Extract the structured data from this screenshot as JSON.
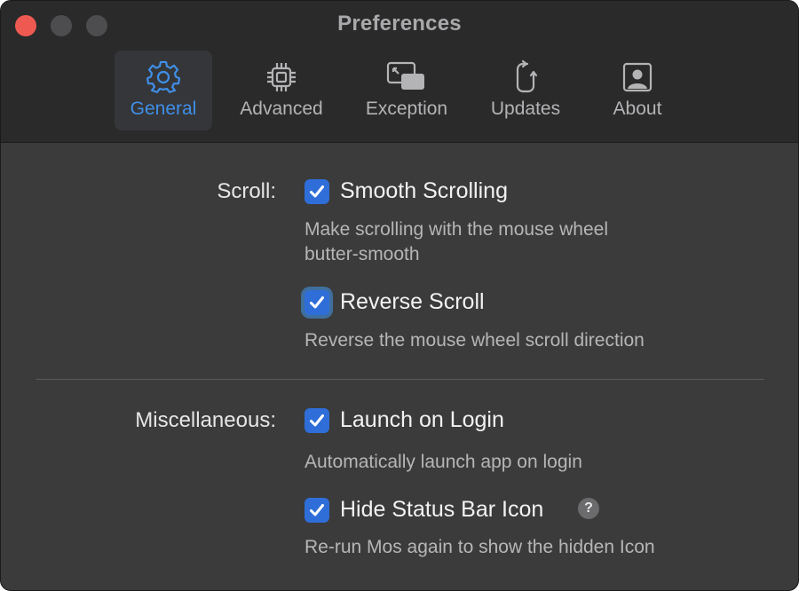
{
  "window": {
    "title": "Preferences",
    "accent_color": "#3f8fe8",
    "checkbox_color": "#2f6ed9"
  },
  "tabs": [
    {
      "label": "General",
      "icon": "gear-icon",
      "active": true
    },
    {
      "label": "Advanced",
      "icon": "chip-icon",
      "active": false
    },
    {
      "label": "Exception",
      "icon": "windows-icon",
      "active": false
    },
    {
      "label": "Updates",
      "icon": "refresh-icon",
      "active": false
    },
    {
      "label": "About",
      "icon": "person-icon",
      "active": false
    }
  ],
  "scroll_section": {
    "label": "Scroll:",
    "options": [
      {
        "label": "Smooth Scrolling",
        "checked": true,
        "description_line1": "Make scrolling with the mouse wheel",
        "description_line2": "butter-smooth"
      },
      {
        "label": "Reverse Scroll",
        "checked": true,
        "description": "Reverse the mouse wheel scroll direction"
      }
    ]
  },
  "misc_section": {
    "label": "Miscellaneous:",
    "options": [
      {
        "label": "Launch on Login",
        "checked": true,
        "description": "Automatically launch app on login"
      },
      {
        "label": "Hide Status Bar Icon",
        "checked": true,
        "description": "Re-run Mos again to show the hidden Icon",
        "help": "?"
      }
    ]
  }
}
